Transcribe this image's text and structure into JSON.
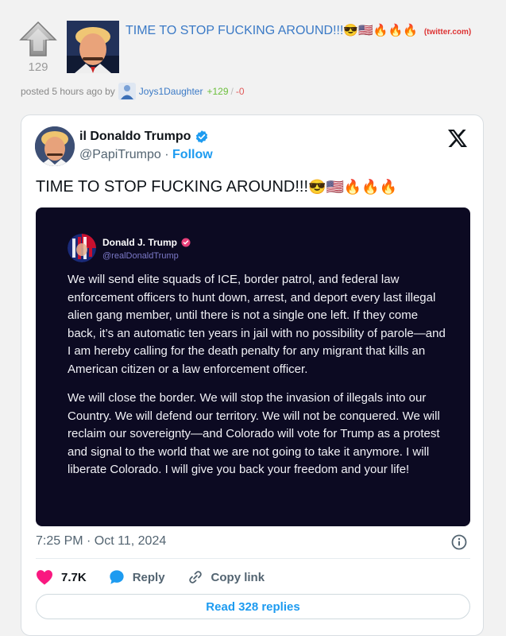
{
  "post": {
    "score": "129",
    "title": "TIME TO STOP FUCKING AROUND!!!",
    "title_emoji": "😎🇺🇸🔥🔥🔥",
    "domain": "(twitter.com)",
    "posted_prefix": "posted 5 hours ago by",
    "author": "Joys1Daughter",
    "upvotes": "+129",
    "separator": "/",
    "downvotes": "-0"
  },
  "tweet": {
    "display_name": "il Donaldo Trumpo",
    "handle": "@PapiTrumpo",
    "dot": " · ",
    "follow_label": "Follow",
    "text": "TIME TO STOP FUCKING AROUND!!!",
    "text_emoji": "😎🇺🇸🔥🔥🔥",
    "timestamp": "7:25 PM · Oct 11, 2024",
    "likes": "7.7K",
    "reply_label": "Reply",
    "copy_link_label": "Copy link",
    "read_replies_label": "Read 328 replies",
    "accent_color": "#1d9bf0",
    "like_color": "#f91880"
  },
  "quote": {
    "display_name": "Donald J. Trump",
    "handle": "@realDonaldTrump",
    "paragraph_1": "We will send elite squads of ICE, border patrol, and federal law enforcement officers to hunt down, arrest, and deport every last illegal alien gang member, until there is not a single one left. If they come back, it’s an automatic ten years in jail with no possibility of parole—and I am hereby calling for the death penalty for any migrant that kills an American citizen or a law enforcement officer.",
    "paragraph_2": "We will close the border. We will stop the invasion of illegals into our Country. We will defend our territory. We will not be conquered. We will reclaim our sovereignty—and Colorado will vote for Trump as a protest and signal to the world that we are not going to take it anymore. I will liberate Colorado. I will give you back your freedom and your life!",
    "background_color": "#0c0a22"
  },
  "icons": [
    "upvote-arrow-icon",
    "verified-badge-icon",
    "x-logo-icon",
    "info-icon",
    "heart-icon",
    "reply-bubble-icon",
    "link-icon"
  ]
}
